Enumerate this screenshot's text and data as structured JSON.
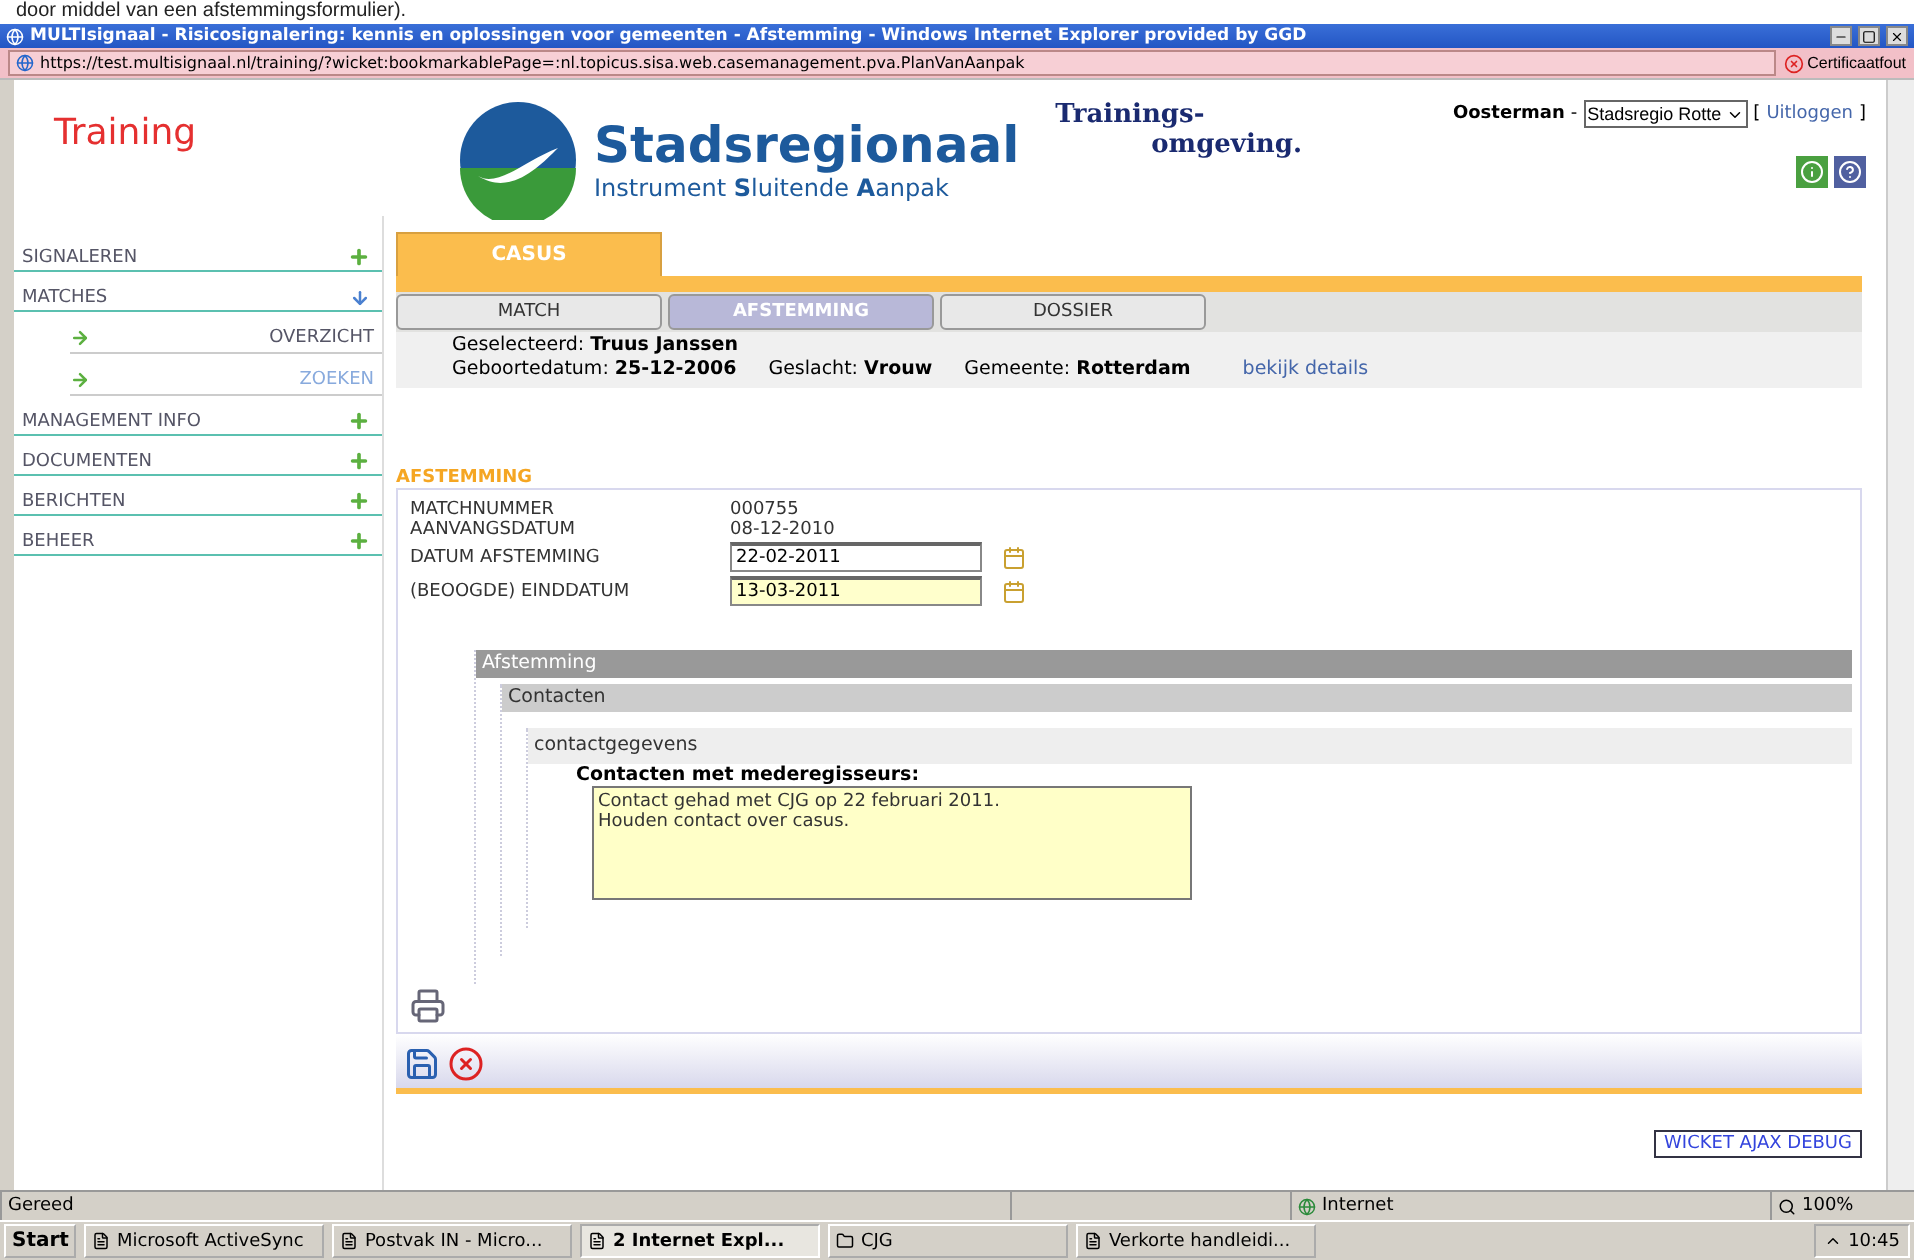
{
  "doc_text": "door middel van een afstemmingsformulier).",
  "window": {
    "title": "MULTIsignaal - Risicosignalering: kennis en oplossingen voor gemeenten - Afstemming - Windows Internet Explorer provided by GGD"
  },
  "address_bar": {
    "url": "https://test.multisignaal.nl/training/?wicket:bookmarkablePage=:nl.topicus.sisa.web.casemanagement.pva.PlanVanAanpak",
    "cert_error": "Certificaatfout"
  },
  "header": {
    "training_label": "Training",
    "logo_title": "Stadsregionaal",
    "logo_subtitle": "Instrument **S**luitende **A**anpak",
    "environment_line_1": "Trainings-",
    "environment_line_2": "omgeving.",
    "user": "Oosterman",
    "separator": "-",
    "org_select": "Stadsregio Rotte",
    "bracket_open": "[",
    "logout": "Uitloggen",
    "bracket_close": "]"
  },
  "sidebar": {
    "items": [
      {
        "label": "SIGNALEREN",
        "expanded": false
      },
      {
        "label": "MATCHES",
        "expanded": true,
        "children": [
          {
            "label": "OVERZICHT",
            "active": false
          },
          {
            "label": "ZOEKEN",
            "active": true
          }
        ]
      },
      {
        "label": "MANAGEMENT INFO",
        "expanded": false
      },
      {
        "label": "DOCUMENTEN",
        "expanded": false
      },
      {
        "label": "BERICHTEN",
        "expanded": false
      },
      {
        "label": "BEHEER",
        "expanded": false
      }
    ]
  },
  "main_tabs": [
    {
      "label": "CASUS",
      "selected": true
    }
  ],
  "sub_tabs": [
    {
      "label": "MATCH",
      "selected": false
    },
    {
      "label": "AFSTEMMING",
      "selected": true
    },
    {
      "label": "DOSSIER",
      "selected": false
    }
  ],
  "client": {
    "line_1": [
      {
        "label": "Geselecteerd:",
        "value": "Truus Janssen"
      }
    ],
    "line_2": [
      {
        "label": "Geboortedatum:",
        "value": "25-12-2006"
      },
      {
        "label": "Geslacht:",
        "value": "Vrouw"
      },
      {
        "label": "Gemeente:",
        "value": "Rotterdam"
      }
    ],
    "details_link": "bekijk details"
  },
  "form": {
    "title": "AFSTEMMING",
    "rows": [
      {
        "kind": "text",
        "label": "MATCHNUMMER",
        "value": "000755"
      },
      {
        "kind": "text",
        "label": "AANVANGSDATUM",
        "value": "08-12-2010"
      },
      {
        "kind": "date",
        "label": "DATUM AFSTEMMING",
        "value": "22-02-2011",
        "highlighted": false
      },
      {
        "kind": "date",
        "label": "(BEOOGDE) EINDDATUM",
        "value": "13-03-2011",
        "highlighted": true
      }
    ]
  },
  "tree": {
    "title": "Afstemming",
    "children": [
      {
        "title": "Contacten",
        "children": [
          {
            "title": "contactgegevens",
            "field": {
              "label": "Contacten met mederegisseurs:",
              "value": "Contact gehad met CJG op 22 februari 2011.\nHouden contact over casus."
            }
          }
        ]
      }
    ]
  },
  "debug_button": "WICKET AJAX DEBUG",
  "status_bar": {
    "status": "Gereed",
    "zone": "Internet",
    "zoom": "100%"
  },
  "taskbar": {
    "start": "Start",
    "tasks": [
      {
        "label": "Microsoft ActiveSync",
        "selected": false
      },
      {
        "label": "Postvak IN - Micro...",
        "selected": false
      },
      {
        "label": "2 Internet Expl...",
        "selected": true
      },
      {
        "label": "CJG",
        "selected": false
      },
      {
        "label": "Verkorte handleidi...",
        "selected": false
      }
    ],
    "clock": "10:45"
  }
}
